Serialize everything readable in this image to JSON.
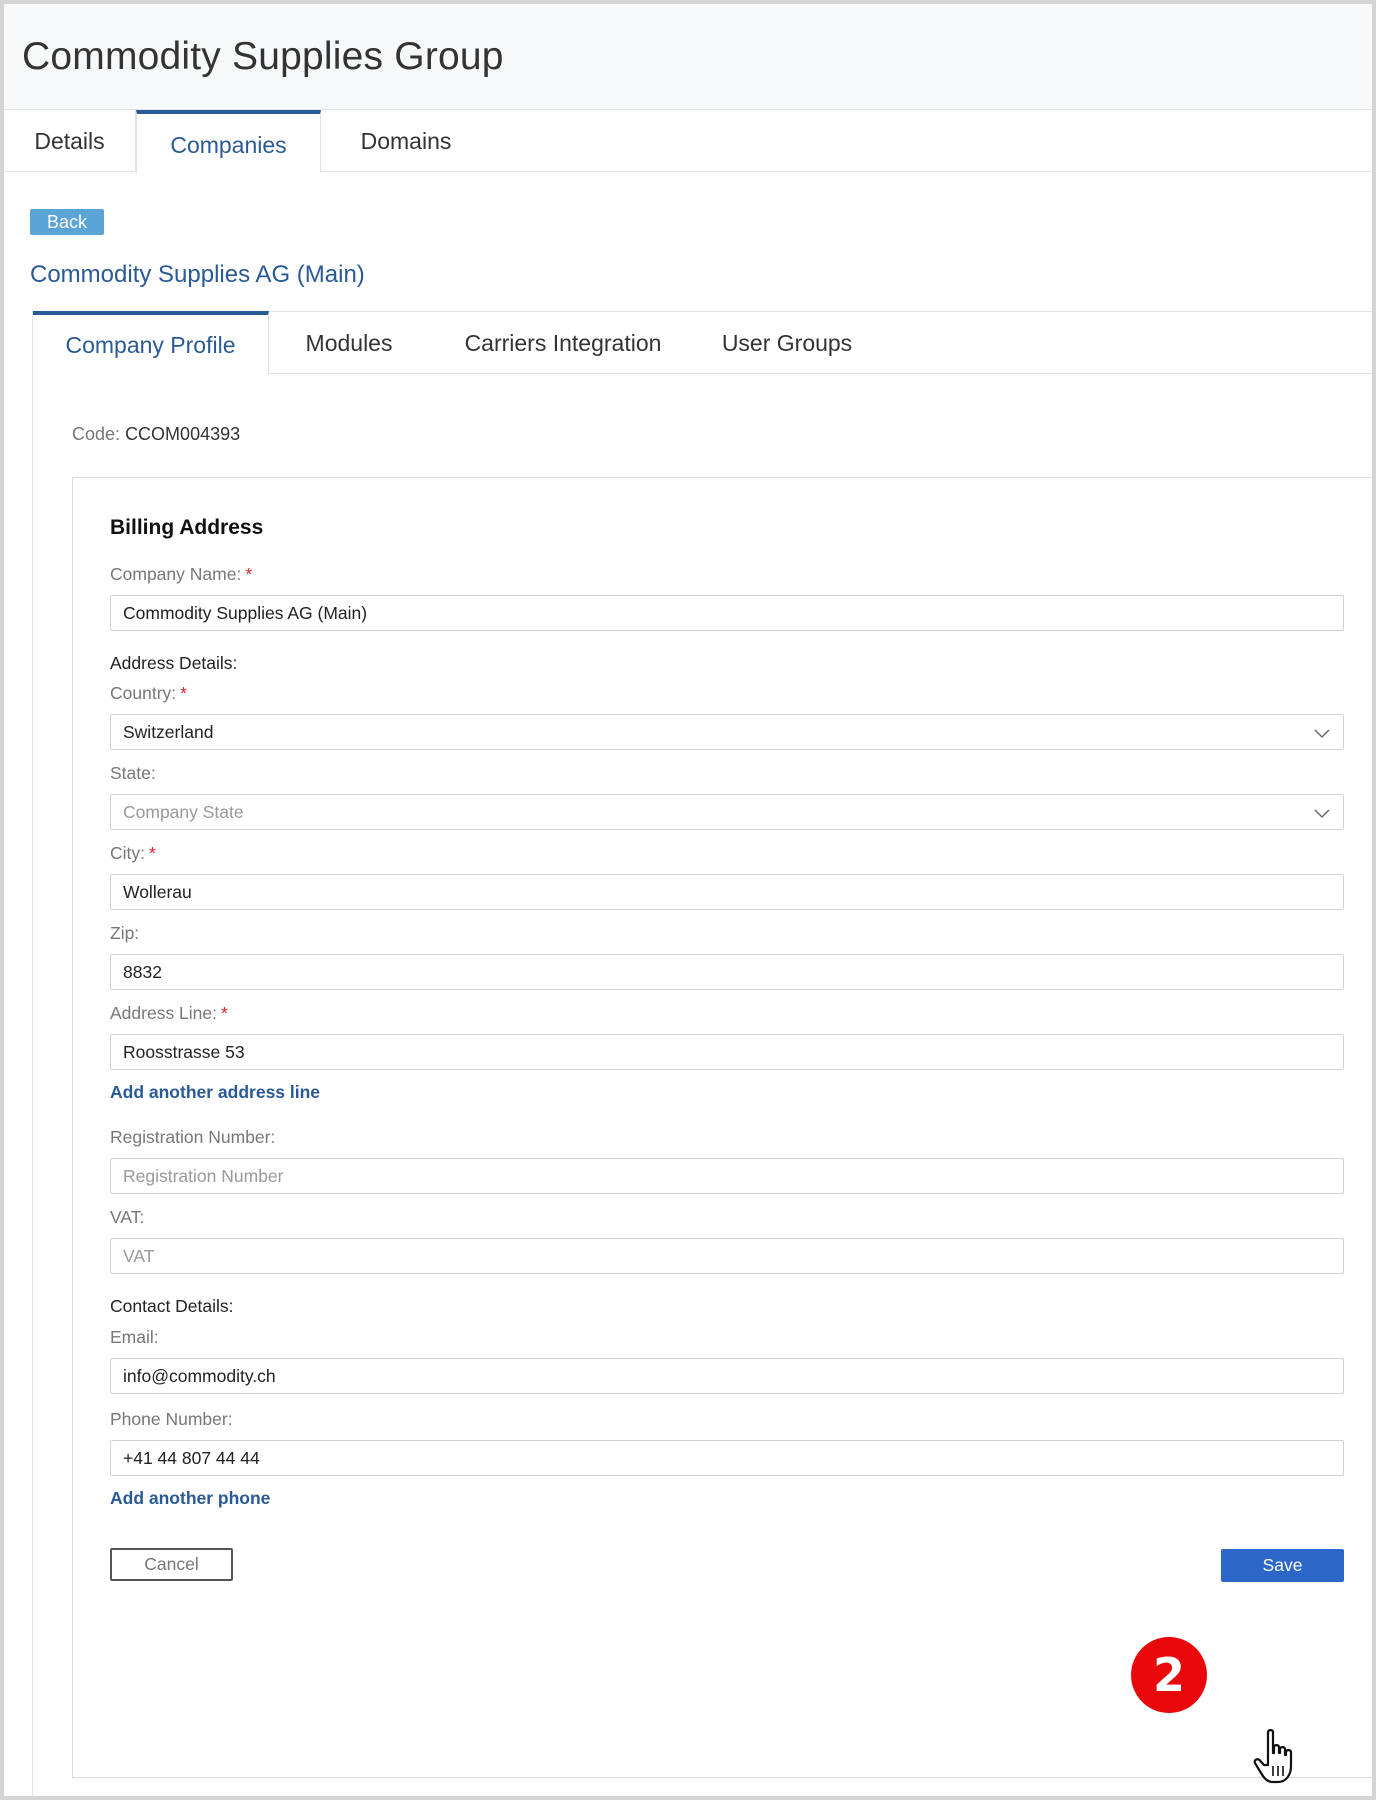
{
  "header": {
    "title": "Commodity Supplies Group"
  },
  "top_tabs": [
    {
      "label": "Details"
    },
    {
      "label": "Companies"
    },
    {
      "label": "Domains"
    }
  ],
  "back_label": "Back",
  "company_title": "Commodity Supplies AG (Main)",
  "sub_tabs": [
    {
      "label": "Company Profile"
    },
    {
      "label": "Modules"
    },
    {
      "label": "Carriers Integration"
    },
    {
      "label": "User Groups"
    }
  ],
  "code": {
    "label": "Code:",
    "value": "CCOM004393"
  },
  "form": {
    "section_title": "Billing Address",
    "company_name": {
      "label": "Company Name:",
      "required": "*",
      "value": "Commodity Supplies AG (Main)"
    },
    "address_details_label": "Address Details:",
    "country": {
      "label": "Country:",
      "required": "*",
      "value": "Switzerland"
    },
    "state": {
      "label": "State:",
      "placeholder": "Company State"
    },
    "city": {
      "label": "City:",
      "required": "*",
      "value": "Wollerau"
    },
    "zip": {
      "label": "Zip:",
      "value": "8832"
    },
    "address_line": {
      "label": "Address Line:",
      "required": "*",
      "value": "Roosstrasse 53"
    },
    "add_address_line": "Add another address line",
    "registration_number": {
      "label": "Registration Number:",
      "placeholder": "Registration Number"
    },
    "vat": {
      "label": "VAT:",
      "placeholder": "VAT"
    },
    "contact_details_label": "Contact Details:",
    "email": {
      "label": "Email:",
      "value": "info@commodity.ch"
    },
    "phone": {
      "label": "Phone Number:",
      "value": "+41 44 807 44 44"
    },
    "add_phone": "Add another phone",
    "cancel_label": "Cancel",
    "save_label": "Save"
  },
  "step_badge": "2",
  "icons": {
    "select": "chevron-down-icon",
    "cursor": "hand-pointer-icon"
  },
  "colors": {
    "accent": "#2a5a96",
    "save": "#2c66c9",
    "back": "#5ba5d6",
    "badge": "#e8070b",
    "required": "#dd2222"
  }
}
